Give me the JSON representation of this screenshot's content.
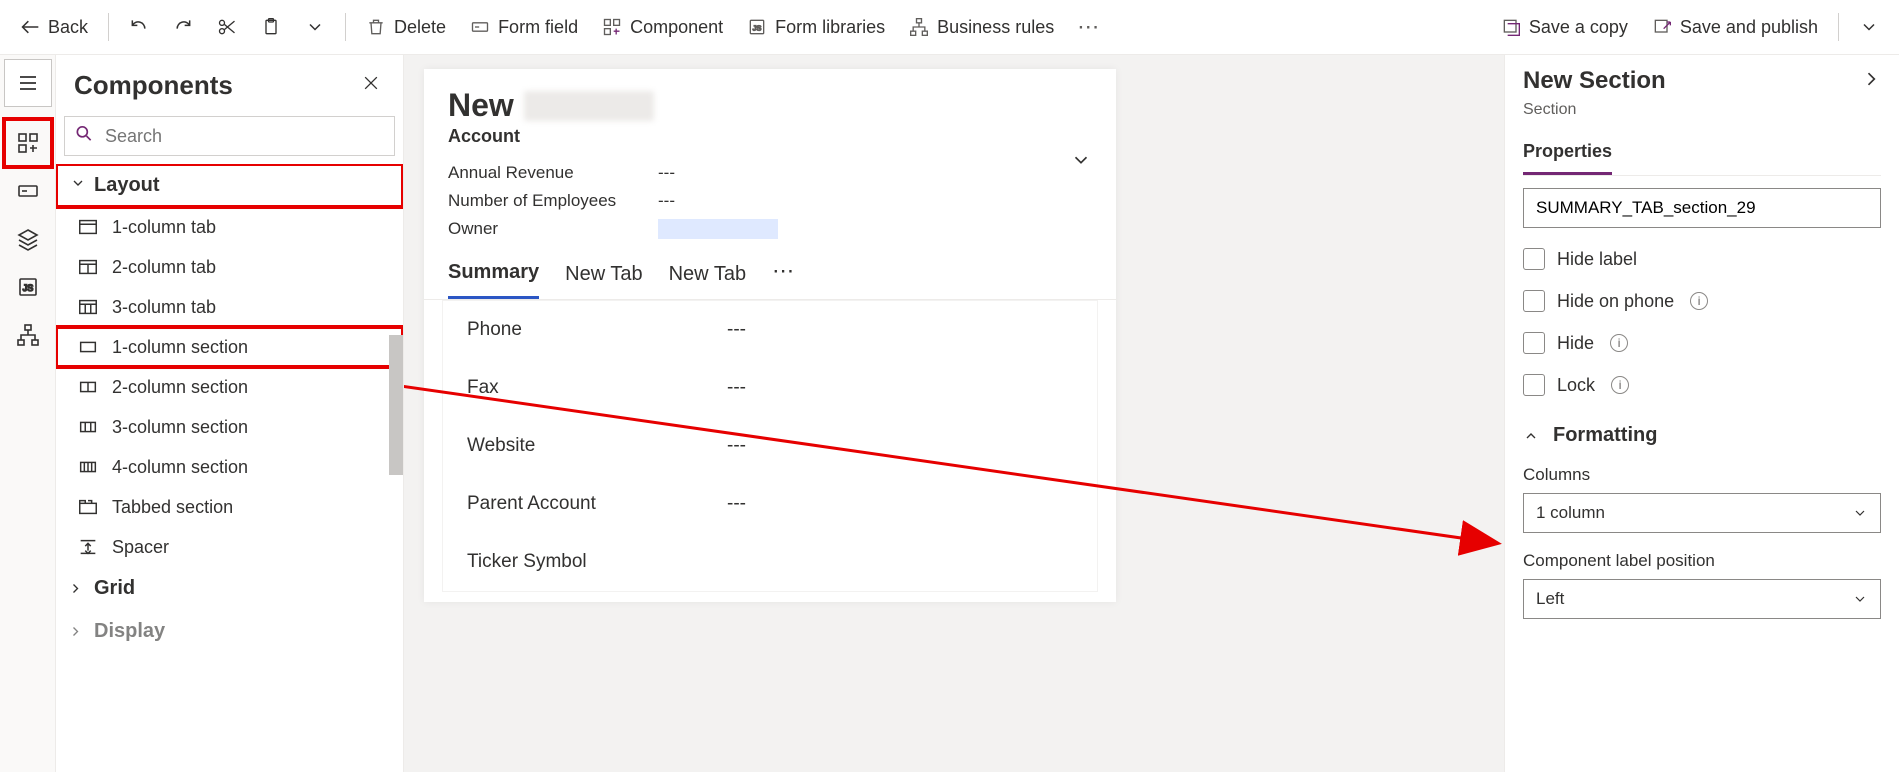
{
  "toolbar": {
    "back": "Back",
    "delete": "Delete",
    "form_field": "Form field",
    "component": "Component",
    "form_libraries": "Form libraries",
    "business_rules": "Business rules",
    "save_copy": "Save a copy",
    "save_publish": "Save and publish"
  },
  "components": {
    "title": "Components",
    "search_placeholder": "Search",
    "groups": {
      "layout": {
        "label": "Layout",
        "items": [
          "1-column tab",
          "2-column tab",
          "3-column tab",
          "1-column section",
          "2-column section",
          "3-column section",
          "4-column section",
          "Tabbed section",
          "Spacer"
        ]
      },
      "grid": {
        "label": "Grid"
      },
      "display": {
        "label": "Display"
      }
    }
  },
  "form": {
    "title_prefix": "New",
    "entity": "Account",
    "meta": {
      "annual_revenue_label": "Annual Revenue",
      "annual_revenue_value": "---",
      "employees_label": "Number of Employees",
      "employees_value": "---",
      "owner_label": "Owner"
    },
    "tabs": [
      "Summary",
      "New Tab",
      "New Tab"
    ],
    "fields": [
      {
        "label": "Phone",
        "value": "---"
      },
      {
        "label": "Fax",
        "value": "---"
      },
      {
        "label": "Website",
        "value": "---"
      },
      {
        "label": "Parent Account",
        "value": "---"
      },
      {
        "label": "Ticker Symbol",
        "value": ""
      }
    ]
  },
  "props": {
    "title": "New Section",
    "subtitle": "Section",
    "tab": "Properties",
    "name_value": "SUMMARY_TAB_section_29",
    "cb_hide_label": "Hide label",
    "cb_hide_phone": "Hide on phone",
    "cb_hide": "Hide",
    "cb_lock": "Lock",
    "formatting": "Formatting",
    "columns_label": "Columns",
    "columns_value": "1 column",
    "label_pos_label": "Component label position",
    "label_pos_value": "Left"
  }
}
